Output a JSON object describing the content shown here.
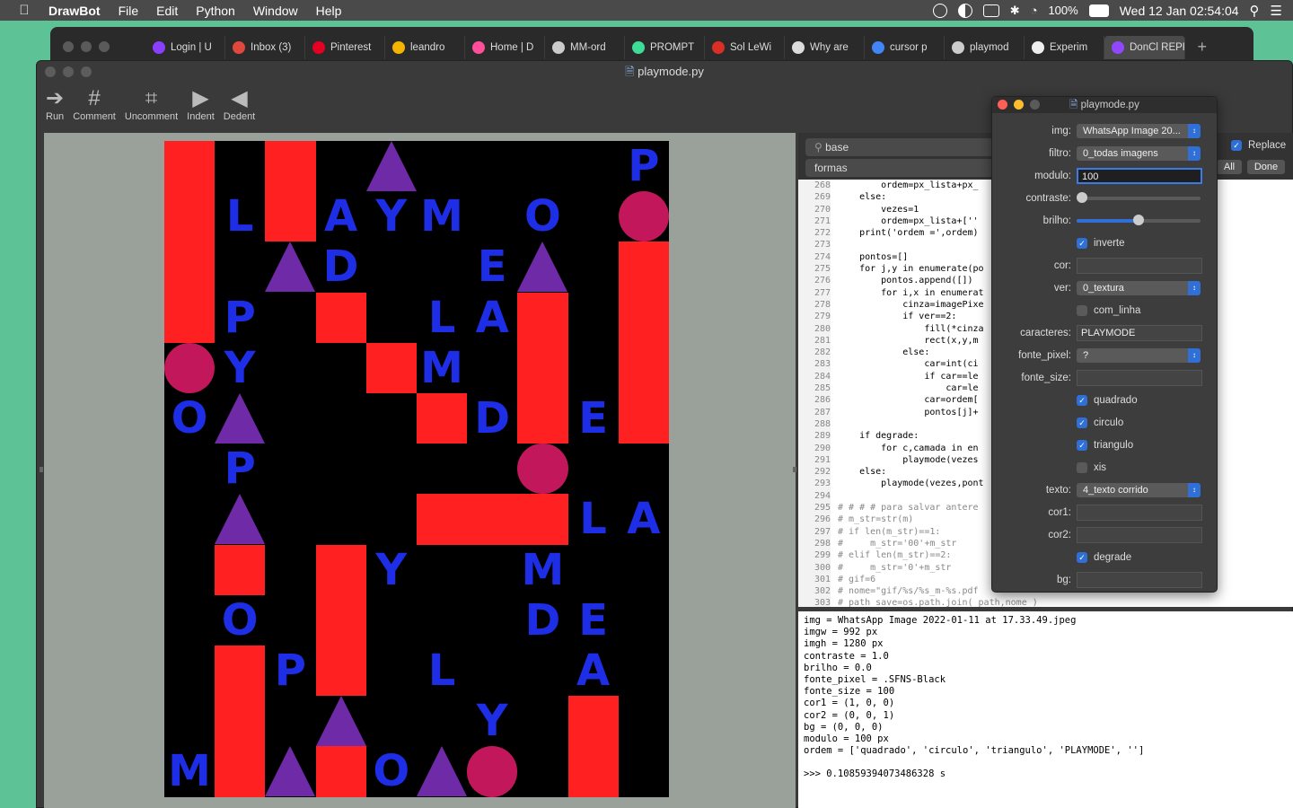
{
  "menubar": {
    "app": "DrawBot",
    "items": [
      "File",
      "Edit",
      "Python",
      "Window",
      "Help"
    ],
    "battery": "100%",
    "datetime": "Wed 12 Jan  02:54:04"
  },
  "browser": {
    "tabs": [
      {
        "label": "Login | U",
        "color": "#8a3ffc"
      },
      {
        "label": "Inbox (3)",
        "color": "#e0483e"
      },
      {
        "label": "Pinterest",
        "color": "#e60023"
      },
      {
        "label": "leandro",
        "color": "#f4b400"
      },
      {
        "label": "Home | D",
        "color": "#ff4f9b"
      },
      {
        "label": "MM-ord",
        "color": "#cccccc"
      },
      {
        "label": "PROMPT",
        "color": "#3ddc97"
      },
      {
        "label": "Sol LeWi",
        "color": "#d93025"
      },
      {
        "label": "Why are",
        "color": "#dddddd"
      },
      {
        "label": "cursor p",
        "color": "#4285f4"
      },
      {
        "label": "playmod",
        "color": "#cccccc"
      },
      {
        "label": "Experim",
        "color": "#eeeeee"
      },
      {
        "label": "DonCl REPRO",
        "color": "#9146ff"
      }
    ]
  },
  "window": {
    "title": "playmode.py",
    "toolbar": [
      "Run",
      "Comment",
      "Uncomment",
      "Indent",
      "Dedent"
    ]
  },
  "search": {
    "find": "base",
    "replace": "formas",
    "replace_label": "Replace",
    "all_label": "All",
    "done_label": "Done"
  },
  "code": [
    {
      "n": "268",
      "t": "        ordem=px_lista+px_"
    },
    {
      "n": "269",
      "t": "    else:"
    },
    {
      "n": "270",
      "t": "        vezes=1"
    },
    {
      "n": "271",
      "t": "        ordem=px_lista+[''"
    },
    {
      "n": "272",
      "t": "    print('ordem =',ordem)"
    },
    {
      "n": "273",
      "t": ""
    },
    {
      "n": "274",
      "t": "    pontos=[]"
    },
    {
      "n": "275",
      "t": "    for j,y in enumerate(po"
    },
    {
      "n": "276",
      "t": "        pontos.append([])"
    },
    {
      "n": "277",
      "t": "        for i,x in enumerat"
    },
    {
      "n": "278",
      "t": "            cinza=imagePixe"
    },
    {
      "n": "279",
      "t": "            if ver==2:"
    },
    {
      "n": "280",
      "t": "                fill(*cinza"
    },
    {
      "n": "281",
      "t": "                rect(x,y,m"
    },
    {
      "n": "282",
      "t": "            else:"
    },
    {
      "n": "283",
      "t": "                car=int(ci"
    },
    {
      "n": "284",
      "t": "                if car==le"
    },
    {
      "n": "285",
      "t": "                    car=le"
    },
    {
      "n": "286",
      "t": "                car=ordem["
    },
    {
      "n": "287",
      "t": "                pontos[j]+"
    },
    {
      "n": "288",
      "t": ""
    },
    {
      "n": "289",
      "t": "    if degrade:"
    },
    {
      "n": "290",
      "t": "        for c,camada in en"
    },
    {
      "n": "291",
      "t": "            playmode(vezes"
    },
    {
      "n": "292",
      "t": "    else:"
    },
    {
      "n": "293",
      "t": "        playmode(vezes,pont"
    },
    {
      "n": "294",
      "t": ""
    },
    {
      "n": "295",
      "t": "# # # # para salvar antere"
    },
    {
      "n": "296",
      "t": "# m_str=str(m)"
    },
    {
      "n": "297",
      "t": "# if len(m_str)==1:"
    },
    {
      "n": "298",
      "t": "#     m_str='00'+m_str"
    },
    {
      "n": "299",
      "t": "# elif len(m_str)==2:"
    },
    {
      "n": "300",
      "t": "#     m_str='0'+m_str"
    },
    {
      "n": "301",
      "t": "# gif=6"
    },
    {
      "n": "302",
      "t": "# nome=\"gif/%s/%s_m-%s.pdf"
    },
    {
      "n": "303",
      "t": "# path_save=os.path.join( path,nome )"
    }
  ],
  "console": [
    "img = WhatsApp Image 2022-01-11 at 17.33.49.jpeg",
    "imgw = 992 px",
    "imgh = 1280 px",
    "contraste = 1.0",
    "brilho = 0.0",
    "fonte_pixel = .SFNS-Black",
    "fonte_size = 100",
    "cor1 = (1, 0, 0)",
    "cor2 = (0, 0, 1)",
    "bg = (0, 0, 0)",
    "modulo = 100 px",
    "ordem = ['quadrado', 'circulo', 'triangulo', 'PLAYMODE', '']",
    "",
    ">>> 0.10859394073486328 s"
  ],
  "panel": {
    "title": "playmode.py",
    "img": "WhatsApp Image 20...",
    "filtro": "0_todas imagens",
    "modulo": "100",
    "contraste": 0.0,
    "brilho": 0.5,
    "inverte": "inverte",
    "ver": "0_textura",
    "com_linha": "com_linha",
    "caracteres": "PLAYMODE",
    "fonte_pixel": "?",
    "quadrado": "quadrado",
    "circulo": "circulo",
    "triangulo": "triangulo",
    "xis": "xis",
    "texto": "4_texto corrido",
    "degrade": "degrade",
    "labels": {
      "img": "img:",
      "filtro": "filtro:",
      "modulo": "modulo:",
      "contraste": "contraste:",
      "brilho": "brilho:",
      "cor": "cor:",
      "ver": "ver:",
      "caracteres": "caracteres:",
      "fonte_pixel": "fonte_pixel:",
      "fonte_size": "fonte_size:",
      "texto": "texto:",
      "cor1": "cor1:",
      "cor2": "cor2:",
      "bg": "bg:"
    }
  },
  "artwork": {
    "colors": {
      "red": "#ff2121",
      "purple": "#6f2aa8",
      "magenta": "#c2185b",
      "blue": "#1d2ee6"
    },
    "cells": [
      {
        "k": "r",
        "c": 0,
        "r": 0,
        "h": 4
      },
      {
        "k": "r",
        "c": 2,
        "r": 0,
        "h": 2
      },
      {
        "k": "t",
        "c": 4,
        "r": 0
      },
      {
        "k": "l",
        "c": 9,
        "r": 0,
        "v": "P"
      },
      {
        "k": "l",
        "c": 1,
        "r": 1,
        "v": "L"
      },
      {
        "k": "l",
        "c": 3,
        "r": 1,
        "v": "A"
      },
      {
        "k": "l",
        "c": 4,
        "r": 1,
        "v": "Y"
      },
      {
        "k": "l",
        "c": 5,
        "r": 1,
        "v": "M"
      },
      {
        "k": "l",
        "c": 7,
        "r": 1,
        "v": "O"
      },
      {
        "k": "c",
        "c": 9,
        "r": 1
      },
      {
        "k": "t",
        "c": 2,
        "r": 2
      },
      {
        "k": "l",
        "c": 3,
        "r": 2,
        "v": "D"
      },
      {
        "k": "l",
        "c": 6,
        "r": 2,
        "v": "E"
      },
      {
        "k": "t",
        "c": 7,
        "r": 2
      },
      {
        "k": "r",
        "c": 9,
        "r": 2,
        "h": 4
      },
      {
        "k": "l",
        "c": 1,
        "r": 3,
        "v": "P"
      },
      {
        "k": "r",
        "c": 3,
        "r": 3,
        "h": 1
      },
      {
        "k": "l",
        "c": 5,
        "r": 3,
        "v": "L"
      },
      {
        "k": "l",
        "c": 6,
        "r": 3,
        "v": "A"
      },
      {
        "k": "r",
        "c": 7,
        "r": 3,
        "h": 3
      },
      {
        "k": "c",
        "c": 0,
        "r": 4
      },
      {
        "k": "l",
        "c": 1,
        "r": 4,
        "v": "Y"
      },
      {
        "k": "r",
        "c": 4,
        "r": 4,
        "h": 1
      },
      {
        "k": "l",
        "c": 5,
        "r": 4,
        "v": "M"
      },
      {
        "k": "l",
        "c": 0,
        "r": 5,
        "v": "O"
      },
      {
        "k": "t",
        "c": 1,
        "r": 5
      },
      {
        "k": "r",
        "c": 5,
        "r": 5,
        "h": 1
      },
      {
        "k": "l",
        "c": 6,
        "r": 5,
        "v": "D"
      },
      {
        "k": "l",
        "c": 8,
        "r": 5,
        "v": "E"
      },
      {
        "k": "l",
        "c": 1,
        "r": 6,
        "v": "P"
      },
      {
        "k": "c",
        "c": 7,
        "r": 6
      },
      {
        "k": "t",
        "c": 1,
        "r": 7
      },
      {
        "k": "r",
        "c": 5,
        "r": 7,
        "h": 1,
        "w": 3
      },
      {
        "k": "l",
        "c": 8,
        "r": 7,
        "v": "L"
      },
      {
        "k": "l",
        "c": 9,
        "r": 7,
        "v": "A"
      },
      {
        "k": "r",
        "c": 1,
        "r": 8,
        "h": 1
      },
      {
        "k": "r",
        "c": 3,
        "r": 8,
        "h": 3
      },
      {
        "k": "l",
        "c": 4,
        "r": 8,
        "v": "Y"
      },
      {
        "k": "l",
        "c": 7,
        "r": 8,
        "v": "M"
      },
      {
        "k": "l",
        "c": 1,
        "r": 9,
        "v": "O"
      },
      {
        "k": "l",
        "c": 7,
        "r": 9,
        "v": "D"
      },
      {
        "k": "l",
        "c": 8,
        "r": 9,
        "v": "E"
      },
      {
        "k": "r",
        "c": 1,
        "r": 10,
        "h": 3
      },
      {
        "k": "l",
        "c": 2,
        "r": 10,
        "v": "P"
      },
      {
        "k": "l",
        "c": 5,
        "r": 10,
        "v": "L"
      },
      {
        "k": "l",
        "c": 8,
        "r": 10,
        "v": "A"
      },
      {
        "k": "t",
        "c": 3,
        "r": 11
      },
      {
        "k": "l",
        "c": 6,
        "r": 11,
        "v": "Y"
      },
      {
        "k": "r",
        "c": 8,
        "r": 11,
        "h": 2
      },
      {
        "k": "l",
        "c": 0,
        "r": 12,
        "v": "M"
      },
      {
        "k": "t",
        "c": 2,
        "r": 12
      },
      {
        "k": "r",
        "c": 3,
        "r": 12,
        "h": 1
      },
      {
        "k": "l",
        "c": 4,
        "r": 12,
        "v": "O"
      },
      {
        "k": "t",
        "c": 5,
        "r": 12
      },
      {
        "k": "c",
        "c": 6,
        "r": 12
      }
    ]
  }
}
